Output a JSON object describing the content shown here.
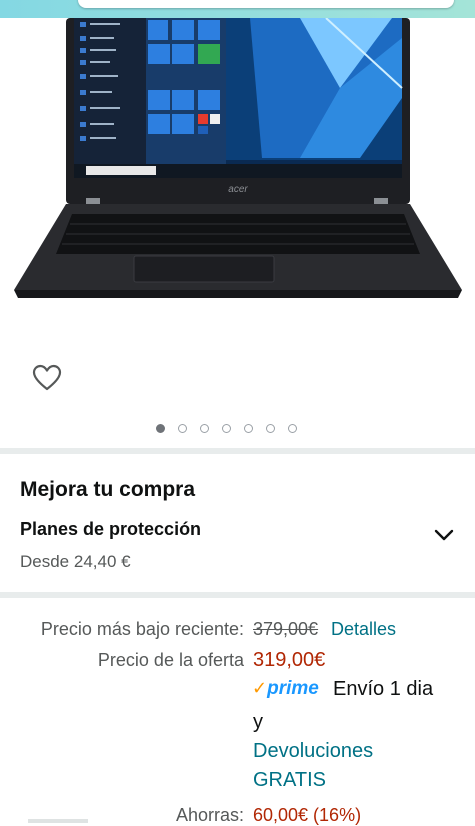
{
  "colors": {
    "price_red": "#B12704",
    "link_teal": "#007185",
    "prime_blue": "#1A98FF",
    "prime_orange": "#FF9900",
    "muted_gray": "#565959"
  },
  "gallery": {
    "laptop_brand": "acer",
    "dots_total": 7,
    "active_dot": 0,
    "wishlist_icon": "heart-outline-icon"
  },
  "upgrade": {
    "title": "Mejora tu compra",
    "plan_title": "Planes de protección",
    "plan_price": "Desde 24,40 €",
    "expand_icon": "chevron-down-icon"
  },
  "pricing": {
    "lowest_label": "Precio más bajo reciente:",
    "lowest_value": "379,00€",
    "details_link": "Detalles",
    "deal_label": "Precio de la oferta",
    "deal_value": "319,00€",
    "prime_check": "✓",
    "prime_word": "prime",
    "shipping_text": "Envío 1 dia",
    "shipping_text_2": "y",
    "returns_line1": "Devoluciones",
    "returns_line2": "GRATIS",
    "savings_label": "Ahorras:",
    "savings_value": "60,00€ (16%)"
  }
}
